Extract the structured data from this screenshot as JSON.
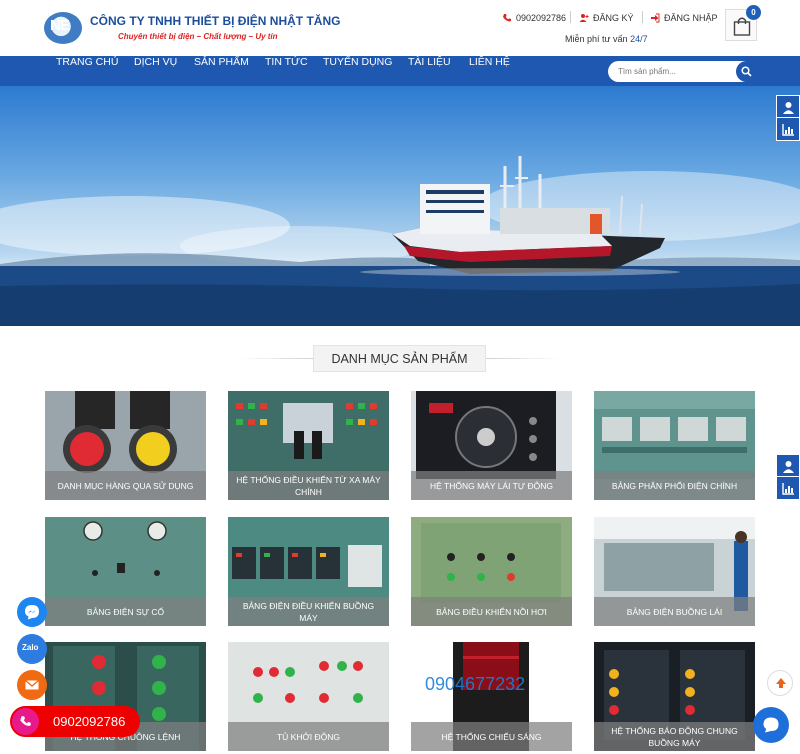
{
  "header": {
    "company_name": "CÔNG TY TNHH THIẾT BỊ ĐIỆN NHẬT TĂNG",
    "slogan": "Chuyên thiết bị điện – Chất lượng – Uy tín",
    "logo_text": "NE",
    "phone": "0902092786",
    "register": "ĐĂNG KÝ",
    "login": "ĐĂNG NHẬP",
    "consult_label": "Miễn phí tư vấn",
    "consult_hours": "24/7",
    "cart_count": "0"
  },
  "nav": {
    "items": [
      "TRANG CHỦ",
      "DỊCH VỤ",
      "SẢN PHẨM",
      "TIN TỨC",
      "TUYỂN DỤNG",
      "TÀI LIỆU",
      "LIÊN HỆ"
    ],
    "search_placeholder": "Tìm sản phẩm..."
  },
  "section": {
    "title": "DANH MỤC SẢN PHẨM"
  },
  "categories": [
    {
      "name": "DANH MỤC HÀNG QUA SỬ DỤNG"
    },
    {
      "name": "HỆ THỐNG ĐIỀU KHIỂN TỪ XA MÁY CHÍNH"
    },
    {
      "name": "HỆ THỐNG MÁY LÁI TỰ ĐỘNG"
    },
    {
      "name": "BẢNG PHÂN PHỐI ĐIỆN CHÍNH"
    },
    {
      "name": "BẢNG ĐIỆN SỰ CỐ"
    },
    {
      "name": "BẢNG ĐIỆN ĐIỀU KHIỂN BUỒNG MÁY"
    },
    {
      "name": "BẢNG ĐIỀU KHIỂN NỒI HƠI"
    },
    {
      "name": "BẢNG ĐIỆN BUỒNG LÁI"
    },
    {
      "name": "HỆ THỐNG CHUÔNG LỆNH"
    },
    {
      "name": "TỦ KHỞI ĐỘNG"
    },
    {
      "name": "HỆ THỐNG CHIẾU SÁNG"
    },
    {
      "name": "HỆ THỐNG BÁO ĐỘNG CHUNG BUỒNG MÁY"
    }
  ],
  "watermark_phone": "0904677232",
  "floating": {
    "phone": "0902092786",
    "icons": [
      "messenger-icon",
      "zalo-icon",
      "email-icon",
      "phone-icon",
      "chat-icon",
      "scroll-top-icon"
    ],
    "zalo_label": "Zalo"
  },
  "colors": {
    "brand_blue": "#1f58b0",
    "accent_red": "#d22",
    "phone_pill": "#e00"
  }
}
